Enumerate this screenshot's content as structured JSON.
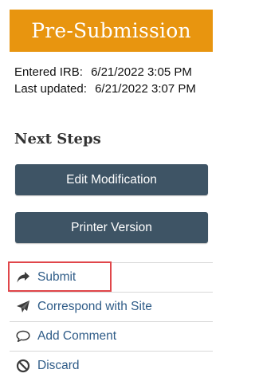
{
  "status": {
    "label": "Pre-Submission",
    "color": "#E8950F"
  },
  "meta": {
    "entered_label": "Entered IRB:",
    "entered_value": "6/21/2022 3:05 PM",
    "updated_label": "Last updated:",
    "updated_value": "6/21/2022 3:07 PM"
  },
  "next_steps": {
    "title": "Next Steps",
    "buttons": [
      {
        "label": "Edit Modification"
      },
      {
        "label": "Printer Version"
      }
    ]
  },
  "actions": [
    {
      "label": "Submit",
      "icon": "share-arrow-icon"
    },
    {
      "label": "Correspond with Site",
      "icon": "paper-plane-icon"
    },
    {
      "label": "Add Comment",
      "icon": "speech-bubble-icon"
    },
    {
      "label": "Discard",
      "icon": "prohibited-icon"
    }
  ],
  "colors": {
    "button_bg": "#3E5465",
    "link": "#2F5C88",
    "highlight": "#E0464A"
  }
}
